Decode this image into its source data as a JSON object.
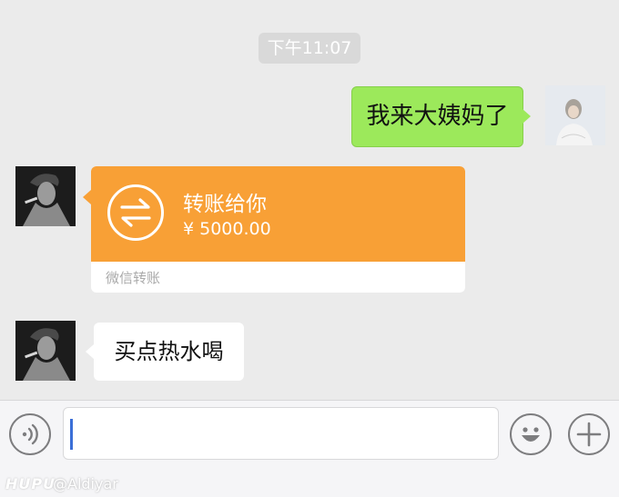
{
  "timestamp": "下午11:07",
  "messages": {
    "sent_text": "我来大姨妈了",
    "transfer": {
      "title": "转账给你",
      "amount": "¥ 5000.00",
      "footer": "微信转账"
    },
    "received_text": "买点热水喝"
  },
  "input": {
    "value": "",
    "placeholder": ""
  },
  "watermark": {
    "brand": "HUPU",
    "user": "@Aldiyar"
  },
  "colors": {
    "chat_background": "#ebebeb",
    "sent_bubble": "#9ce95b",
    "transfer_orange": "#f8a036",
    "received_bubble": "#ffffff",
    "input_caret": "#3b6fd7"
  },
  "icons": [
    "voice-icon",
    "transfer-icon",
    "emoji-icon",
    "plus-icon"
  ]
}
